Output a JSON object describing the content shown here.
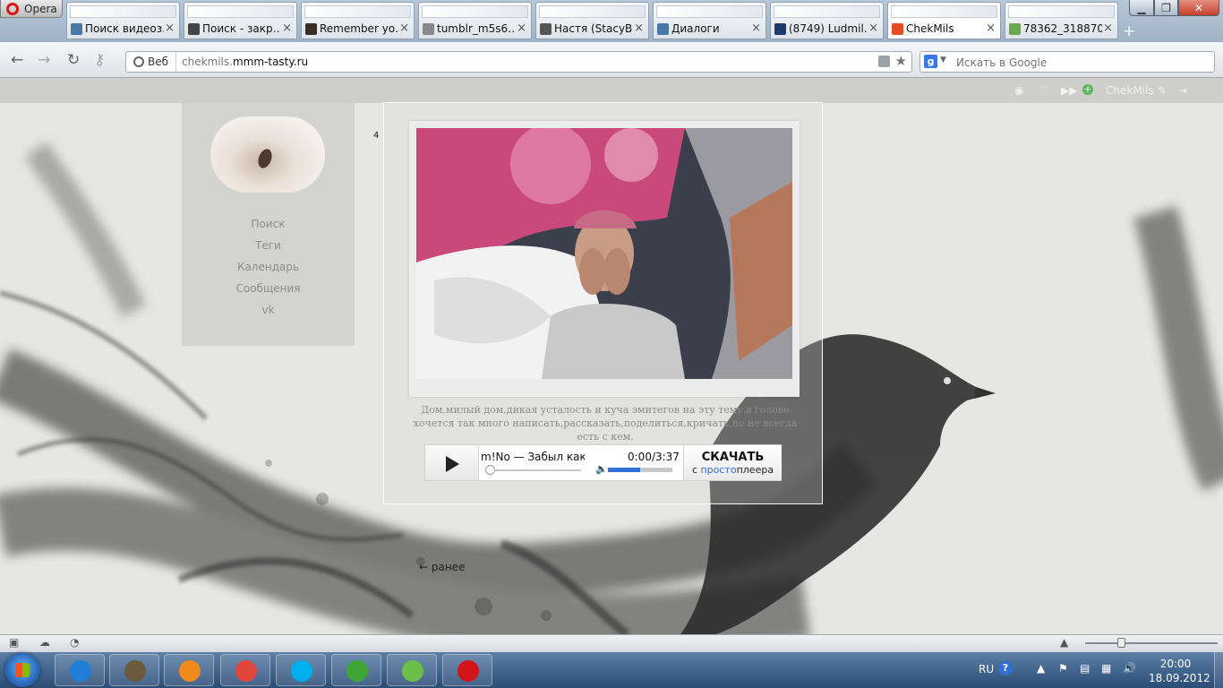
{
  "browser": {
    "menu_label": "Opera",
    "tabs": [
      {
        "label": "Поиск видеоз…",
        "icon_color": "#4a76a8"
      },
      {
        "label": "Поиск - закр…",
        "icon_color": "#444444"
      },
      {
        "label": "Remember yo…",
        "icon_color": "#3a2d25"
      },
      {
        "label": "tumblr_m5s6…",
        "icon_color": "#888888"
      },
      {
        "label": "Настя (StacyB…",
        "icon_color": "#555555"
      },
      {
        "label": "Диалоги",
        "icon_color": "#4a76a8"
      },
      {
        "label": "(8749) Ludmil…",
        "icon_color": "#1e3a6b"
      },
      {
        "label": "ChekMils",
        "icon_color": "#e44d26"
      },
      {
        "label": "78362_318870…",
        "icon_color": "#6aa84f"
      }
    ],
    "active_tab_index": 7,
    "address": {
      "chip_label": "Веб",
      "url_prefix": "chekmils.",
      "url_domain": "mmm-tasty.ru"
    },
    "search": {
      "engine_letter": "g",
      "placeholder": "Искать в Google"
    }
  },
  "tumblr_bar": {
    "username": "ChekMils"
  },
  "sidebar": {
    "links": [
      {
        "label": "Поиск"
      },
      {
        "label": "Теги"
      },
      {
        "label": "Календарь"
      },
      {
        "label": "Сообщения"
      },
      {
        "label": "vk"
      }
    ]
  },
  "post": {
    "count": "4",
    "caption": "Дом,милый дом,дикая усталость и куча эмитегов на эту тему,в голове хочется так много написать,рассказать,поделиться,кричать,но не всегда есть с кем.",
    "player": {
      "track_title": "m!No — Забыл как",
      "time": "0:00/3:37",
      "progress": 0.0,
      "volume": 0.5,
      "download_label": "СКАЧАТЬ",
      "download_sub_prefix": "с ",
      "download_sub_brand": "просто",
      "download_sub_suffix": "плеера"
    },
    "older_link": "← ранее"
  },
  "taskbar": {
    "language": "RU",
    "help": "?",
    "time": "20:00",
    "date": "18.09.2012",
    "apps": [
      {
        "name": "internet-explorer",
        "color": "#1f7fd6"
      },
      {
        "name": "film-maker",
        "color": "#6b5a3c"
      },
      {
        "name": "media-player",
        "color": "#f08a1c"
      },
      {
        "name": "chrome",
        "color": "#e0463a"
      },
      {
        "name": "skype",
        "color": "#00aff0"
      },
      {
        "name": "utorrent",
        "color": "#3fa535"
      },
      {
        "name": "icq",
        "color": "#6cc04a"
      },
      {
        "name": "opera",
        "color": "#d2141a"
      }
    ]
  }
}
